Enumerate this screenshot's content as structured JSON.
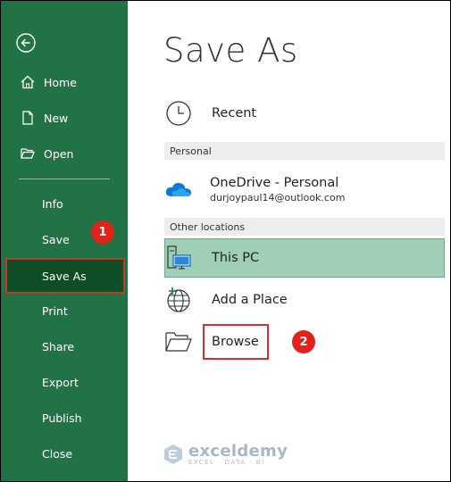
{
  "sidebar": {
    "back_icon": "back-arrow-icon",
    "items": [
      {
        "label": "Home",
        "icon": "home-icon"
      },
      {
        "label": "New",
        "icon": "new-document-icon"
      },
      {
        "label": "Open",
        "icon": "open-folder-icon"
      },
      {
        "label": "Info"
      },
      {
        "label": "Save"
      },
      {
        "label": "Save As",
        "selected": true
      },
      {
        "label": "Print"
      },
      {
        "label": "Share"
      },
      {
        "label": "Export"
      },
      {
        "label": "Publish"
      },
      {
        "label": "Close"
      }
    ]
  },
  "main": {
    "title": "Save As",
    "recent": {
      "label": "Recent",
      "icon": "clock-icon"
    },
    "personal_header": "Personal",
    "onedrive": {
      "label": "OneDrive - Personal",
      "email": "durjoypaul14@outlook.com",
      "icon": "cloud-icon"
    },
    "other_header": "Other locations",
    "this_pc": {
      "label": "This PC",
      "icon": "computer-icon",
      "selected": true
    },
    "add_place": {
      "label": "Add a Place",
      "icon": "globe-plus-icon"
    },
    "browse": {
      "label": "Browse",
      "icon": "folder-icon"
    }
  },
  "annotations": {
    "step1": "1",
    "step2": "2"
  },
  "watermark": {
    "name": "exceldemy",
    "tagline": "EXCEL · DATA · BI"
  },
  "colors": {
    "sidebar": "#217346",
    "selected_nav": "#0e4d26",
    "selected_location": "#9fcfb4",
    "badge": "#e3211b",
    "onedrive": "#0f78d4"
  }
}
